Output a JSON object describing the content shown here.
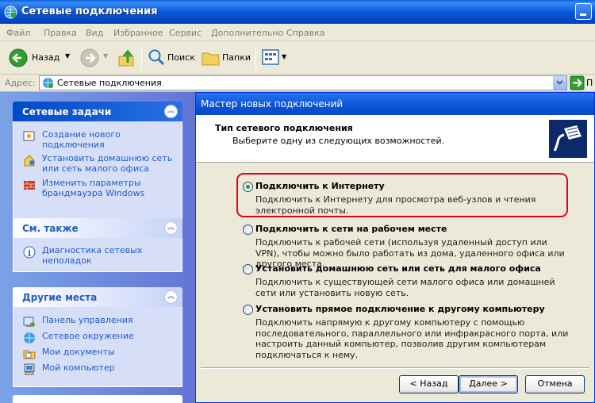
{
  "window": {
    "title": "Сетевые подключения"
  },
  "menu": [
    "Файл",
    "Правка",
    "Вид",
    "Избранное",
    "Сервис",
    "Дополнительно",
    "Справка"
  ],
  "toolbar": {
    "back_label": "Назад",
    "search_label": "Поиск",
    "folders_label": "Папки"
  },
  "address": {
    "label": "Адрес:",
    "value": "Сетевые подключения",
    "go_label": "П"
  },
  "sidebar": {
    "network_tasks": {
      "title": "Сетевые задачи",
      "items": [
        {
          "label": "Создание нового подключения",
          "icon": "new-connection-icon"
        },
        {
          "label": "Установить домашнюю сеть или сеть малого офиса",
          "icon": "home-network-icon"
        },
        {
          "label": "Изменить параметры брандмауэра Windows",
          "icon": "firewall-icon"
        }
      ]
    },
    "see_also": {
      "title": "См. также",
      "items": [
        {
          "label": "Диагностика сетевых неполадок",
          "icon": "info-icon"
        }
      ]
    },
    "other_places": {
      "title": "Другие места",
      "items": [
        {
          "label": "Панель управления",
          "icon": "control-panel-icon"
        },
        {
          "label": "Сетевое окружение",
          "icon": "network-places-icon"
        },
        {
          "label": "Мои документы",
          "icon": "my-documents-icon"
        },
        {
          "label": "Мой компьютер",
          "icon": "my-computer-icon"
        }
      ]
    }
  },
  "wizard": {
    "title": "Мастер новых подключений",
    "header_title": "Тип сетевого подключения",
    "header_subtitle": "Выберите одну из следующих возможностей.",
    "options": [
      {
        "label": "Подключить к Интернету",
        "desc": "Подключить к Интернету для просмотра веб-узлов и чтения  электронной почты.",
        "checked": true
      },
      {
        "label": "Подключить к сети на рабочем месте",
        "desc": "Подключить к рабочей сети (используя удаленный доступ или VPN), чтобы можно было работать из дома, удаленного офиса или другого места.",
        "checked": false
      },
      {
        "label": "Установить домашнюю сеть или сеть для малого офиса",
        "desc": "Подключить к существующей сети малого офиса или домашней сети или установить новую сеть.",
        "checked": false
      },
      {
        "label": "Установить прямое подключение к другому компьютеру",
        "desc": "Подключить напрямую к другому компьютеру с помощью последовательного, параллельного или инфракрасного порта, или настроить данный компьютер, позволив другим  компьютерам подключаться к нему.",
        "checked": false
      }
    ],
    "buttons": {
      "back": "< Назад",
      "next": "Далее >",
      "cancel": "Отмена"
    }
  }
}
